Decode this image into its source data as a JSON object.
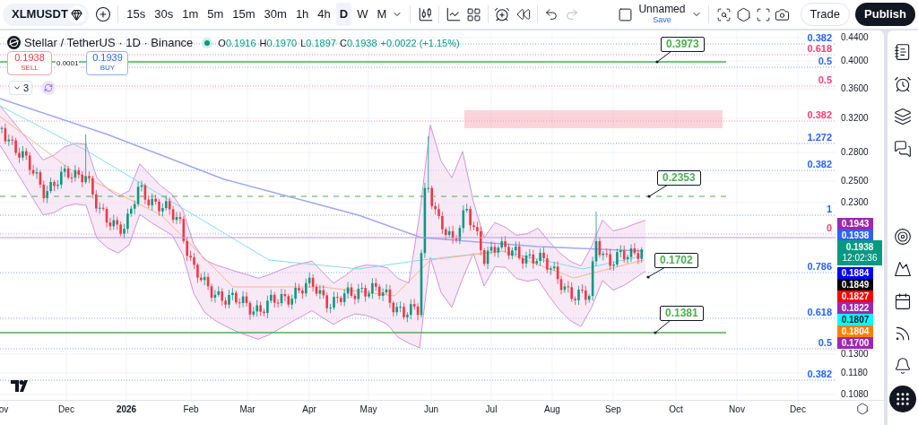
{
  "symbol_search": {
    "value": "XLMUSDT"
  },
  "intervals": [
    {
      "label": "15s",
      "selected": false
    },
    {
      "label": "30s",
      "selected": false
    },
    {
      "label": "1m",
      "selected": false
    },
    {
      "label": "5m",
      "selected": false
    },
    {
      "label": "15m",
      "selected": false
    },
    {
      "label": "30m",
      "selected": false
    },
    {
      "label": "1h",
      "selected": false
    },
    {
      "label": "4h",
      "selected": false
    },
    {
      "label": "D",
      "selected": true
    },
    {
      "label": "W",
      "selected": false
    },
    {
      "label": "M",
      "selected": false
    }
  ],
  "layout": {
    "name": "Unnamed",
    "save": "Save"
  },
  "buttons": {
    "trade": "Trade",
    "publish": "Publish"
  },
  "legend": {
    "title": "Stellar / TetherUS · 1D · Binance",
    "ohlc": [
      {
        "key": "O",
        "value": "0.1916"
      },
      {
        "key": "H",
        "value": "0.1970"
      },
      {
        "key": "L",
        "value": "0.1897"
      },
      {
        "key": "C",
        "value": "0.1938"
      }
    ],
    "change": "+0.0022 (+1.15%)"
  },
  "sell": {
    "price": "0.1938",
    "label": "SELL"
  },
  "spread": "0.0001",
  "buy": {
    "price": "0.1939",
    "label": "BUY"
  },
  "indicators_toggle": {
    "count": "3"
  },
  "callouts": [
    {
      "value": "0.3973",
      "kind": "solid"
    },
    {
      "value": "0.2353",
      "kind": "dashed"
    },
    {
      "value": "0.1702",
      "kind": "plain"
    },
    {
      "value": "0.1381",
      "kind": "solid"
    }
  ],
  "fib_levels": [
    {
      "label": "0.382",
      "color": "#2962ff"
    },
    {
      "label": "0.618",
      "color": "#f23f6f"
    },
    {
      "label": "0.5",
      "color": "#2962ff"
    },
    {
      "label": "0.5",
      "color": "#f23f6f"
    },
    {
      "label": "0.382",
      "color": "#f23f6f"
    },
    {
      "label": "1.272",
      "color": "#2962ff"
    },
    {
      "label": "0.382",
      "color": "#2962ff"
    },
    {
      "label": "1",
      "color": "#2962ff"
    },
    {
      "label": "0",
      "color": "#f23f6f"
    },
    {
      "label": "0.786",
      "color": "#2962ff"
    },
    {
      "label": "0.618",
      "color": "#2962ff"
    },
    {
      "label": "0.5",
      "color": "#2962ff"
    },
    {
      "label": "0.382",
      "color": "#2962ff"
    }
  ],
  "price_axis": [
    "0.4400",
    "0.4000",
    "0.3600",
    "0.3200",
    "0.2800",
    "0.2500",
    "0.2300",
    "0.1300",
    "0.1180",
    "0.1080"
  ],
  "price_tags": [
    {
      "value": "0.1943",
      "color": "#9c27b0"
    },
    {
      "value": "0.1938",
      "color": "#2962ff"
    },
    {
      "value": "0.1884",
      "color": "#0000ff"
    },
    {
      "value": "0.1849",
      "color": "#000000"
    },
    {
      "value": "0.1827",
      "color": "#ff0000"
    },
    {
      "value": "0.1822",
      "color": "#9c27b0"
    },
    {
      "value": "0.1807",
      "color": "#00ffff"
    },
    {
      "value": "0.1804",
      "color": "#ff7f00"
    },
    {
      "value": "0.1700",
      "color": "#9c27b0"
    }
  ],
  "last_price": {
    "value": "0.1938",
    "countdown": "12:02:36"
  },
  "time_axis": [
    {
      "label": "ov",
      "bold": false
    },
    {
      "label": "Dec",
      "bold": false
    },
    {
      "label": "2026",
      "bold": true
    },
    {
      "label": "Feb",
      "bold": false
    },
    {
      "label": "Mar",
      "bold": false
    },
    {
      "label": "Apr",
      "bold": false
    },
    {
      "label": "May",
      "bold": false
    },
    {
      "label": "Jun",
      "bold": false
    },
    {
      "label": "Jul",
      "bold": false
    },
    {
      "label": "Aug",
      "bold": false
    },
    {
      "label": "Sep",
      "bold": false
    },
    {
      "label": "Oct",
      "bold": false
    },
    {
      "label": "Nov",
      "bold": false
    },
    {
      "label": "Dec",
      "bold": false
    }
  ]
}
